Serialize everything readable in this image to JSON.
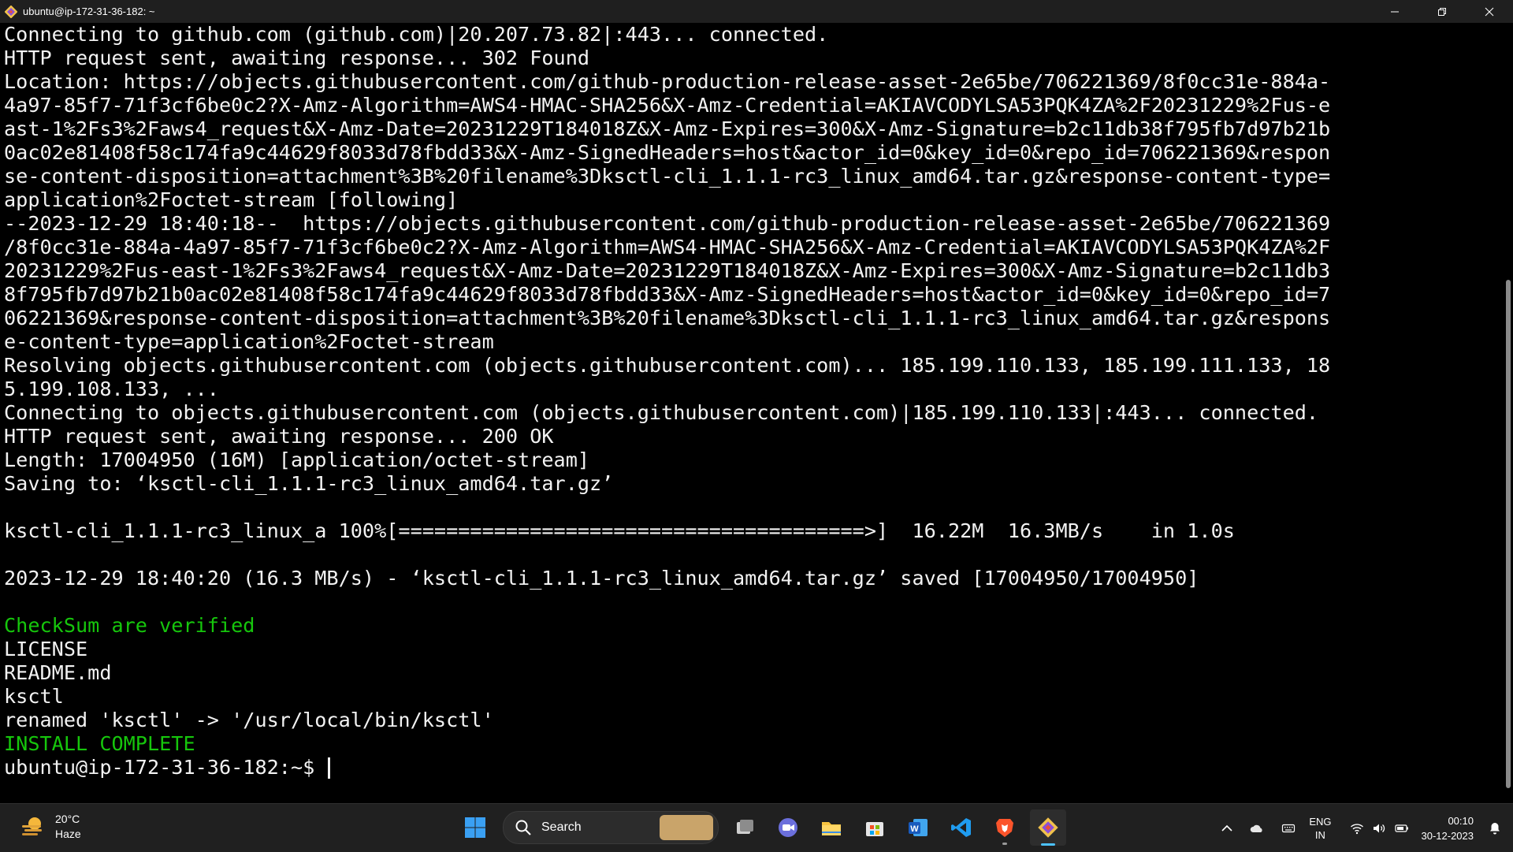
{
  "window": {
    "title": "ubuntu@ip-172-31-36-182: ~",
    "controls": {
      "minimize": "minimize-icon",
      "maximize": "restore-icon",
      "close": "close-icon"
    }
  },
  "terminal": {
    "lines": [
      {
        "text": "Connecting to github.com (github.com)|20.207.73.82|:443... connected.",
        "color": "default"
      },
      {
        "text": "HTTP request sent, awaiting response... 302 Found",
        "color": "default"
      },
      {
        "text": "Location: https://objects.githubusercontent.com/github-production-release-asset-2e65be/706221369/8f0cc31e-884a-",
        "color": "default"
      },
      {
        "text": "4a97-85f7-71f3cf6be0c2?X-Amz-Algorithm=AWS4-HMAC-SHA256&X-Amz-Credential=AKIAVCODYLSA53PQK4ZA%2F20231229%2Fus-e",
        "color": "default"
      },
      {
        "text": "ast-1%2Fs3%2Faws4_request&X-Amz-Date=20231229T184018Z&X-Amz-Expires=300&X-Amz-Signature=b2c11db38f795fb7d97b21b",
        "color": "default"
      },
      {
        "text": "0ac02e81408f58c174fa9c44629f8033d78fbdd33&X-Amz-SignedHeaders=host&actor_id=0&key_id=0&repo_id=706221369&respon",
        "color": "default"
      },
      {
        "text": "se-content-disposition=attachment%3B%20filename%3Dksctl-cli_1.1.1-rc3_linux_amd64.tar.gz&response-content-type=",
        "color": "default"
      },
      {
        "text": "application%2Foctet-stream [following]",
        "color": "default"
      },
      {
        "text": "--2023-12-29 18:40:18--  https://objects.githubusercontent.com/github-production-release-asset-2e65be/706221369",
        "color": "default"
      },
      {
        "text": "/8f0cc31e-884a-4a97-85f7-71f3cf6be0c2?X-Amz-Algorithm=AWS4-HMAC-SHA256&X-Amz-Credential=AKIAVCODYLSA53PQK4ZA%2F",
        "color": "default"
      },
      {
        "text": "20231229%2Fus-east-1%2Fs3%2Faws4_request&X-Amz-Date=20231229T184018Z&X-Amz-Expires=300&X-Amz-Signature=b2c11db3",
        "color": "default"
      },
      {
        "text": "8f795fb7d97b21b0ac02e81408f58c174fa9c44629f8033d78fbdd33&X-Amz-SignedHeaders=host&actor_id=0&key_id=0&repo_id=7",
        "color": "default"
      },
      {
        "text": "06221369&response-content-disposition=attachment%3B%20filename%3Dksctl-cli_1.1.1-rc3_linux_amd64.tar.gz&respons",
        "color": "default"
      },
      {
        "text": "e-content-type=application%2Foctet-stream",
        "color": "default"
      },
      {
        "text": "Resolving objects.githubusercontent.com (objects.githubusercontent.com)... 185.199.110.133, 185.199.111.133, 18",
        "color": "default"
      },
      {
        "text": "5.199.108.133, ...",
        "color": "default"
      },
      {
        "text": "Connecting to objects.githubusercontent.com (objects.githubusercontent.com)|185.199.110.133|:443... connected.",
        "color": "default"
      },
      {
        "text": "HTTP request sent, awaiting response... 200 OK",
        "color": "default"
      },
      {
        "text": "Length: 17004950 (16M) [application/octet-stream]",
        "color": "default"
      },
      {
        "text": "Saving to: ‘ksctl-cli_1.1.1-rc3_linux_amd64.tar.gz’",
        "color": "default"
      },
      {
        "text": "",
        "color": "default"
      },
      {
        "text": "ksctl-cli_1.1.1-rc3_linux_a 100%[=======================================>]  16.22M  16.3MB/s    in 1.0s",
        "color": "default"
      },
      {
        "text": "",
        "color": "default"
      },
      {
        "text": "2023-12-29 18:40:20 (16.3 MB/s) - ‘ksctl-cli_1.1.1-rc3_linux_amd64.tar.gz’ saved [17004950/17004950]",
        "color": "default"
      },
      {
        "text": "",
        "color": "default"
      },
      {
        "text": "CheckSum are verified",
        "color": "green"
      },
      {
        "text": "LICENSE",
        "color": "default"
      },
      {
        "text": "README.md",
        "color": "default"
      },
      {
        "text": "ksctl",
        "color": "default"
      },
      {
        "text": "renamed 'ksctl' -> '/usr/local/bin/ksctl'",
        "color": "default"
      },
      {
        "text": "INSTALL COMPLETE",
        "color": "green"
      }
    ],
    "prompt": "ubuntu@ip-172-31-36-182:~$ ",
    "colors": {
      "default": "#f2f2f2",
      "green": "#16c60c",
      "background": "#000000"
    }
  },
  "taskbar": {
    "weather": {
      "temp": "20°C",
      "condition": "Haze",
      "icon": "haze-icon"
    },
    "search": {
      "label": "Search",
      "icon": "search-icon"
    },
    "apps": [
      {
        "name": "start-button",
        "icon": "windows-logo-icon"
      },
      {
        "name": "task-view-button",
        "icon": "task-view-icon"
      },
      {
        "name": "meet-button",
        "icon": "video-camera-icon"
      },
      {
        "name": "file-explorer-button",
        "icon": "folder-icon"
      },
      {
        "name": "microsoft-store-button",
        "icon": "store-icon"
      },
      {
        "name": "word-button",
        "icon": "word-icon"
      },
      {
        "name": "vscode-button",
        "icon": "vscode-icon"
      },
      {
        "name": "brave-button",
        "icon": "brave-lion-icon"
      },
      {
        "name": "git-bash-button",
        "icon": "git-icon"
      }
    ],
    "tray": {
      "lang_top": "ENG",
      "lang_bottom": "IN",
      "time": "00:10",
      "date": "30-12-2023"
    },
    "accent": "#4cc2ff"
  }
}
